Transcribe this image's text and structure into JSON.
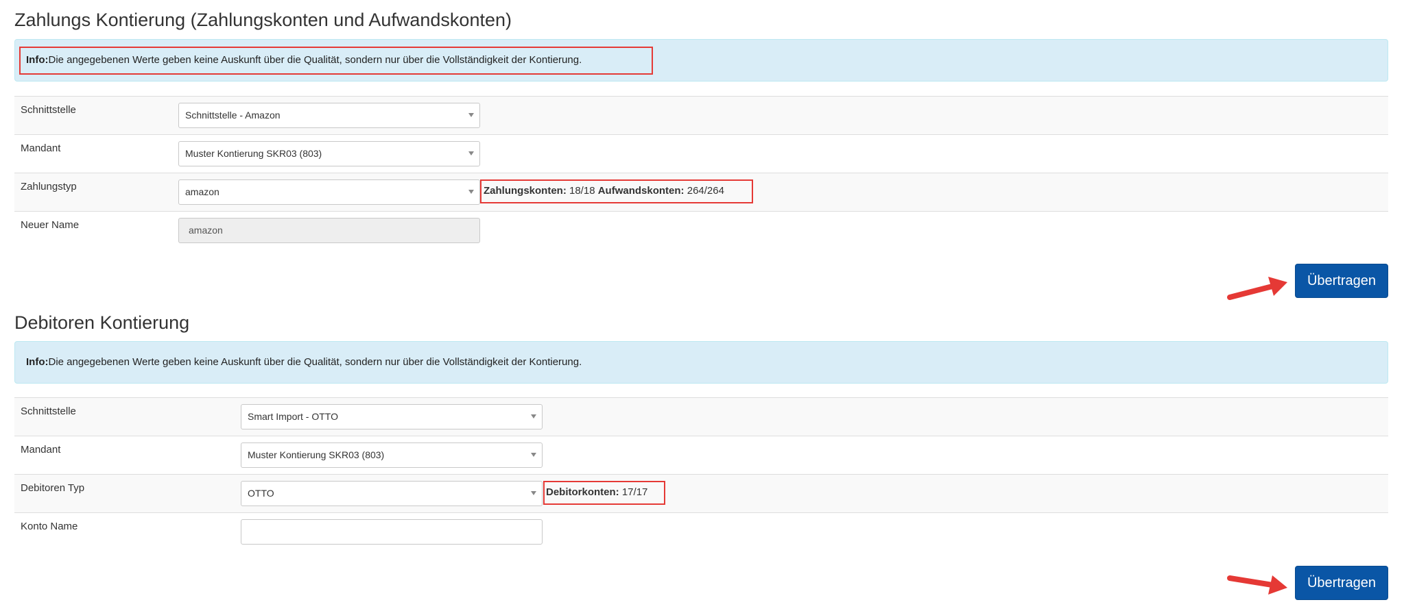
{
  "section1": {
    "title": "Zahlungs Kontierung (Zahlungskonten und Aufwandskonten)",
    "info_label": "Info:",
    "info_text": "Die angegebenen Werte geben keine Auskunft über die Qualität, sondern nur über die Vollständigkeit der Kontierung.",
    "rows": [
      {
        "label": "Schnittstelle",
        "value": "Schnittstelle - Amazon"
      },
      {
        "label": "Mandant",
        "value": "Muster Kontierung SKR03 (803)"
      },
      {
        "label": "Zahlungstyp",
        "value": "amazon"
      },
      {
        "label": "Neuer Name",
        "value": "amazon"
      }
    ],
    "counts": {
      "label1": "Zahlungskonten:",
      "value1": "18/18",
      "label2": "Aufwandskonten:",
      "value2": "264/264"
    },
    "button_label": "Übertragen"
  },
  "section2": {
    "title": "Debitoren Kontierung",
    "info_label": "Info:",
    "info_text": "Die angegebenen Werte geben keine Auskunft über die Qualität, sondern nur über die Vollständigkeit der Kontierung.",
    "rows": [
      {
        "label": "Schnittstelle",
        "value": "Smart Import - OTTO"
      },
      {
        "label": "Mandant",
        "value": "Muster Kontierung SKR03 (803)"
      },
      {
        "label": "Debitoren Typ",
        "value": "OTTO"
      },
      {
        "label": "Konto Name",
        "value": ""
      }
    ],
    "counts": {
      "label1": "Debitorkonten:",
      "value1": "17/17"
    },
    "button_label": "Übertragen"
  },
  "colors": {
    "info_bg": "#d9edf7",
    "highlight": "#e53935",
    "button": "#0a56a6"
  }
}
